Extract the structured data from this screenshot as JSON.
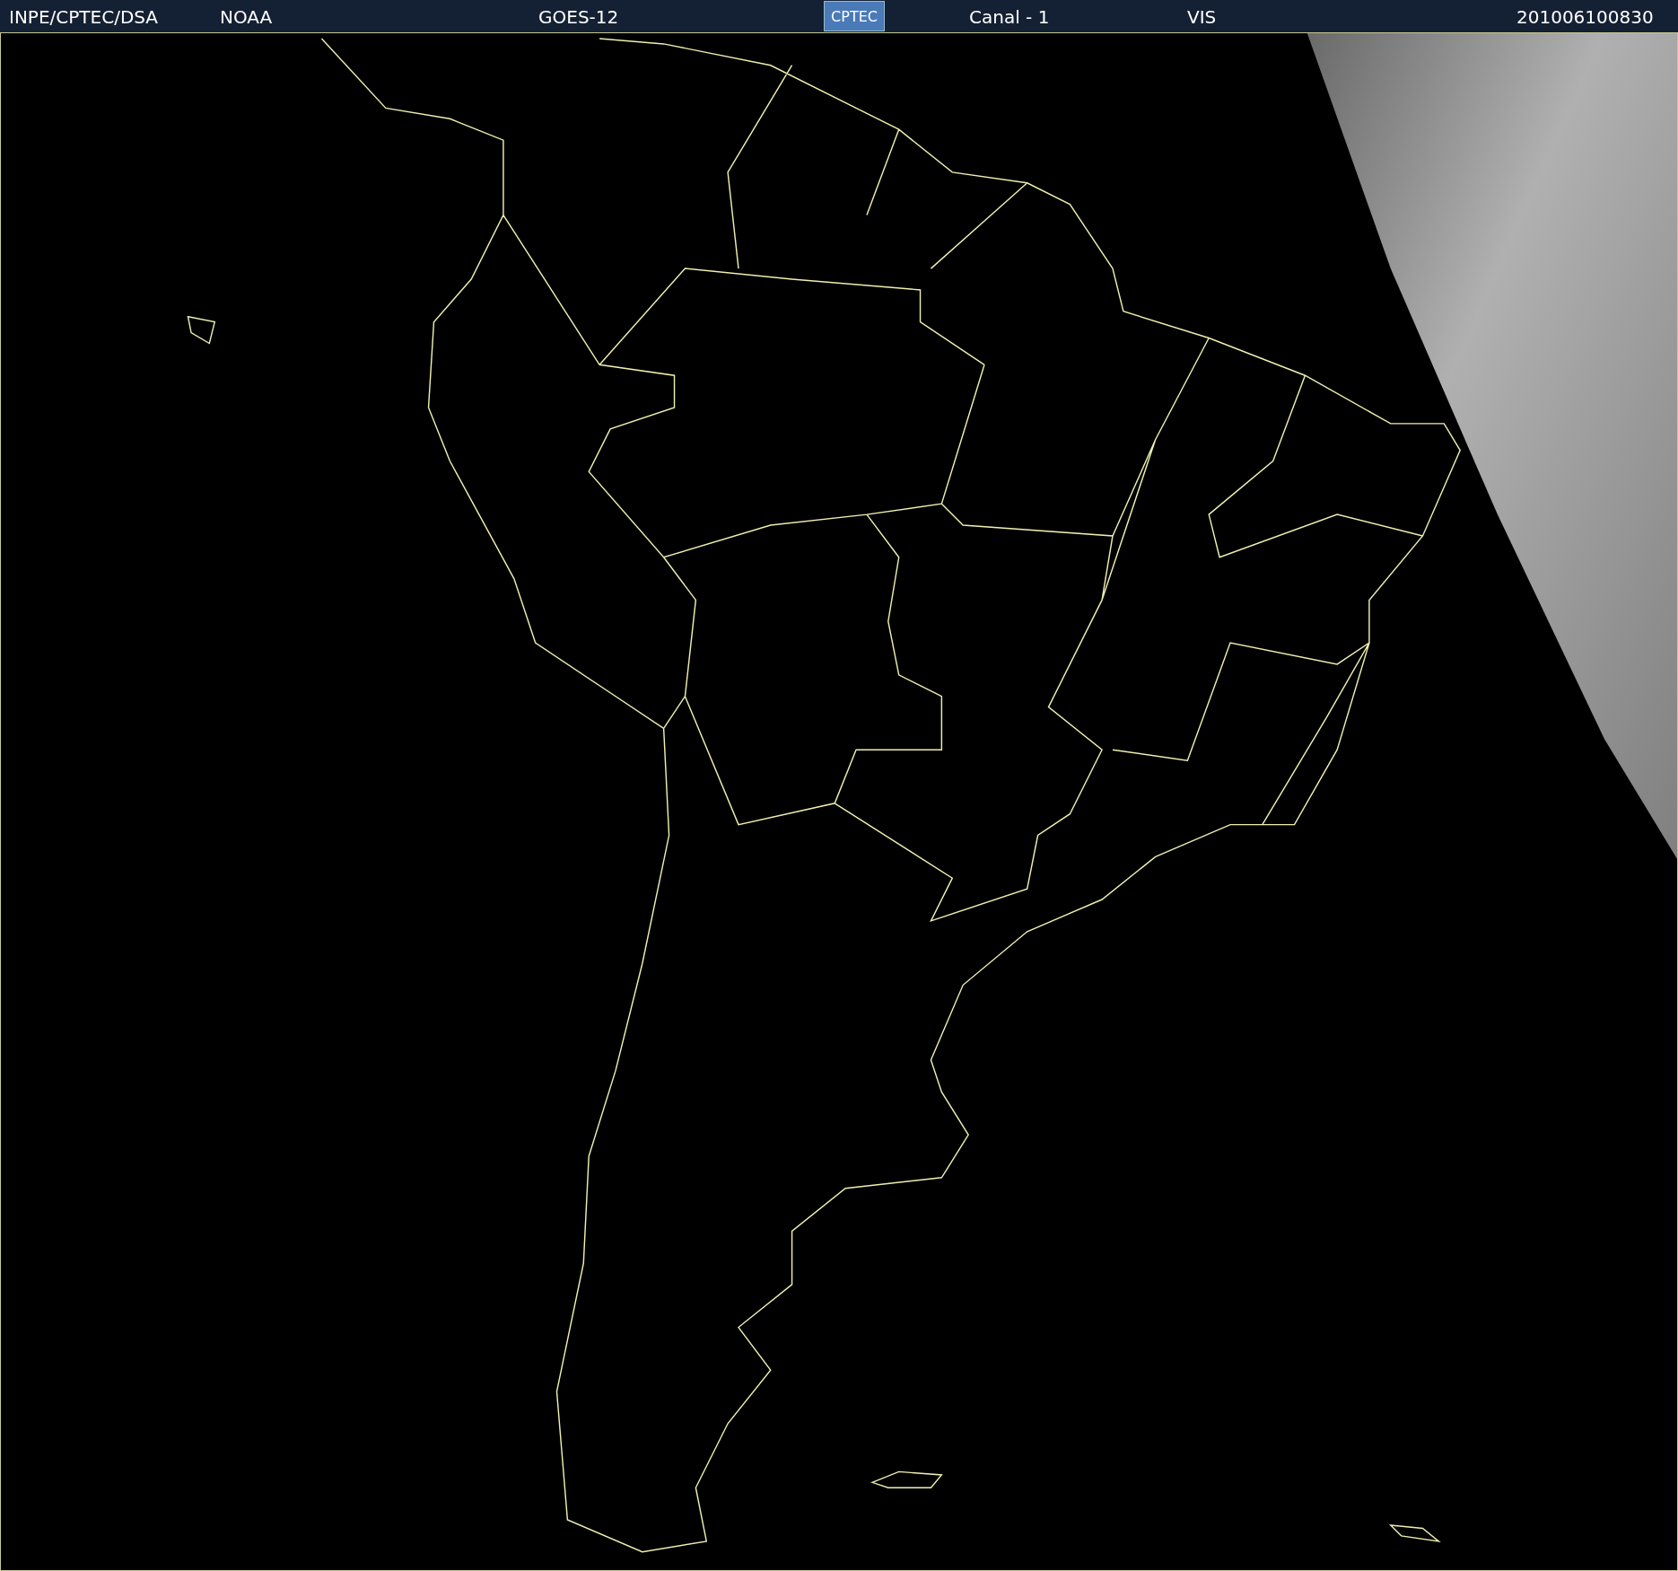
{
  "header": {
    "items": [
      {
        "kind": "text",
        "text": "INPE/CPTEC/DSA"
      },
      {
        "kind": "text",
        "text": "NOAA"
      },
      {
        "kind": "text",
        "text": "GOES-12"
      },
      {
        "kind": "logo",
        "text": "CPTEC"
      },
      {
        "kind": "text",
        "text": "Canal - 1"
      },
      {
        "kind": "text",
        "text": "VIS"
      },
      {
        "kind": "text",
        "text": "201006100830"
      }
    ]
  }
}
